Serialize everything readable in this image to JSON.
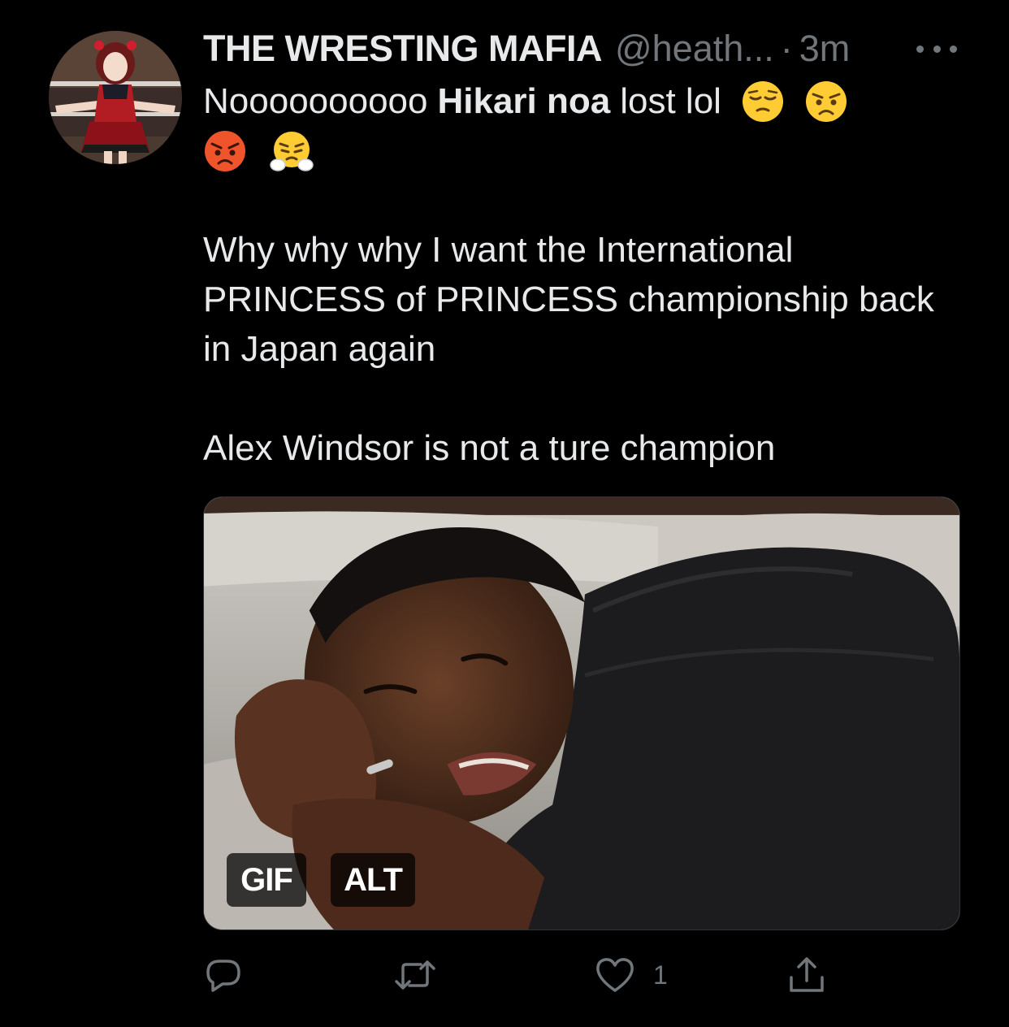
{
  "tweet": {
    "display_name": "THE WRESTING MAFIA",
    "handle": "@heath...",
    "separator": "·",
    "time": "3m",
    "text": {
      "prefix": "Noooooooooo",
      "bold": "Hikari noa",
      "suffix": "lost lol",
      "paragraph2": "Why why why I want the International PRINCESS of PRINCESS championship back in Japan again",
      "paragraph3": "Alex Windsor is not a ture champion"
    },
    "emojis": [
      "pensive-face",
      "persevering-face",
      "angry-face",
      "face-with-steam"
    ],
    "media": {
      "gif_badge": "GIF",
      "alt_badge": "ALT"
    },
    "actions": {
      "like_count": "1"
    }
  }
}
